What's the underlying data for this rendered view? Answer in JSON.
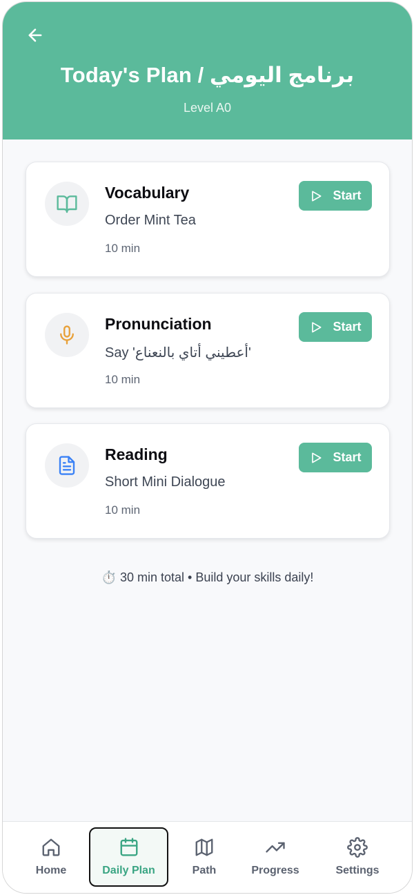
{
  "header": {
    "title": "برنامج اليومي / Today's Plan",
    "level": "Level A0",
    "bg_color": "#5bba9b"
  },
  "cards": [
    {
      "title": "Vocabulary",
      "subtitle": "Order Mint Tea",
      "duration": "10 min",
      "icon": "book-open-icon",
      "icon_color": "#5bba9b",
      "start_label": "Start"
    },
    {
      "title": "Pronunciation",
      "subtitle": "Say 'أعطيني أتاي بالنعناع'",
      "duration": "10 min",
      "icon": "microphone-icon",
      "icon_color": "#e8a13a",
      "start_label": "Start"
    },
    {
      "title": "Reading",
      "subtitle": "Short Mini Dialogue",
      "duration": "10 min",
      "icon": "document-icon",
      "icon_color": "#3b82f6",
      "start_label": "Start"
    }
  ],
  "footer": {
    "emoji": "⏱️",
    "text": "30 min total • Build your skills daily!"
  },
  "nav": {
    "items": [
      {
        "label": "Home",
        "icon": "home-icon"
      },
      {
        "label": "Daily Plan",
        "icon": "calendar-icon",
        "active": true
      },
      {
        "label": "Path",
        "icon": "map-icon"
      },
      {
        "label": "Progress",
        "icon": "trending-up-icon"
      },
      {
        "label": "Settings",
        "icon": "gear-icon"
      }
    ]
  },
  "colors": {
    "accent": "#5bba9b",
    "active_nav_text": "#3aa583"
  }
}
